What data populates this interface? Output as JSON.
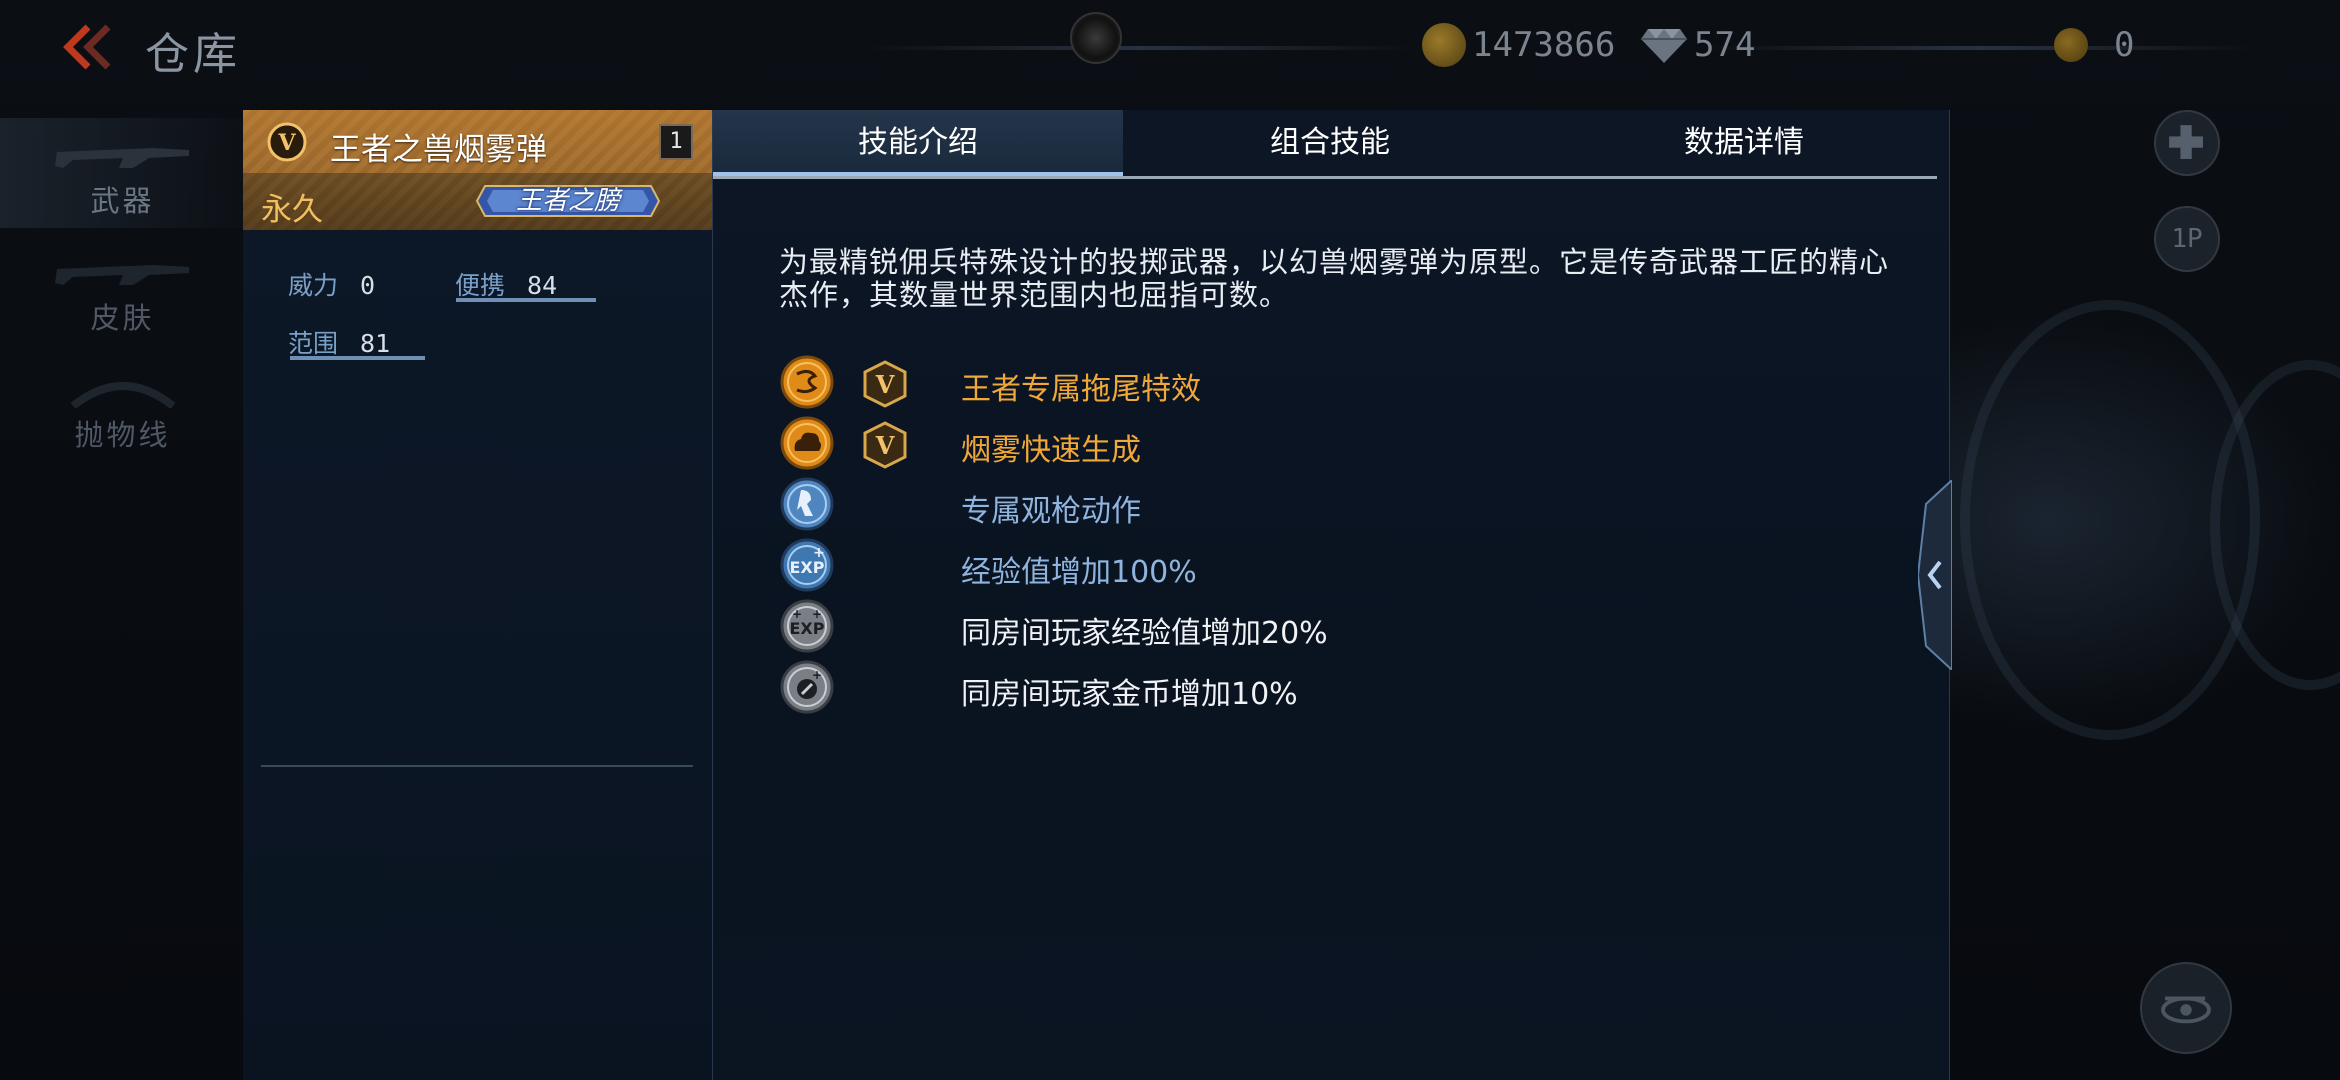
{
  "topbar": {
    "title": "仓库",
    "currency_coins": "1473866",
    "currency_diamonds": "574",
    "currency_gold": "0"
  },
  "sidebar": {
    "items": [
      {
        "label": "武器",
        "active": true
      },
      {
        "label": "皮肤",
        "active": false
      },
      {
        "label": "抛物线",
        "active": false
      }
    ]
  },
  "item": {
    "name": "王者之兽烟雾弹",
    "count": "1",
    "duration": "永久",
    "badge_label": "王者之膀",
    "stats": [
      {
        "label": "威力",
        "value": "0"
      },
      {
        "label": "便携",
        "value": "84"
      },
      {
        "label": "范围",
        "value": "81"
      }
    ]
  },
  "detail": {
    "tabs": [
      {
        "label": "技能介绍",
        "active": true
      },
      {
        "label": "组合技能",
        "active": false
      },
      {
        "label": "数据详情",
        "active": false
      }
    ],
    "description": "为最精锐佣兵特殊设计的投掷武器，以幻兽烟雾弹为原型。它是传奇武器工匠的精心杰作，其数量世界范围内也屈指可数。",
    "skills": [
      {
        "icon": "trail-icon",
        "king_badge": true,
        "text": "王者专属拖尾特效",
        "color": "gold"
      },
      {
        "icon": "smoke-icon",
        "king_badge": true,
        "text": "烟雾快速生成",
        "color": "gold"
      },
      {
        "icon": "gun-inspect-icon",
        "king_badge": false,
        "text": "专属观枪动作",
        "color": "blue"
      },
      {
        "icon": "exp-icon",
        "king_badge": false,
        "text": "经验值增加100%",
        "color": "blue"
      },
      {
        "icon": "room-exp-icon",
        "king_badge": false,
        "text": "同房间玩家经验值增加20%",
        "color": "white"
      },
      {
        "icon": "room-coin-icon",
        "king_badge": false,
        "text": "同房间玩家金币增加10%",
        "color": "white"
      }
    ]
  },
  "right": {
    "badge_1p": "1P"
  },
  "colors": {
    "accent_gold": "#f0a838",
    "accent_blue": "#8fb4de",
    "header_gold": "#b5803a",
    "panel_bg": "#0c1625"
  }
}
